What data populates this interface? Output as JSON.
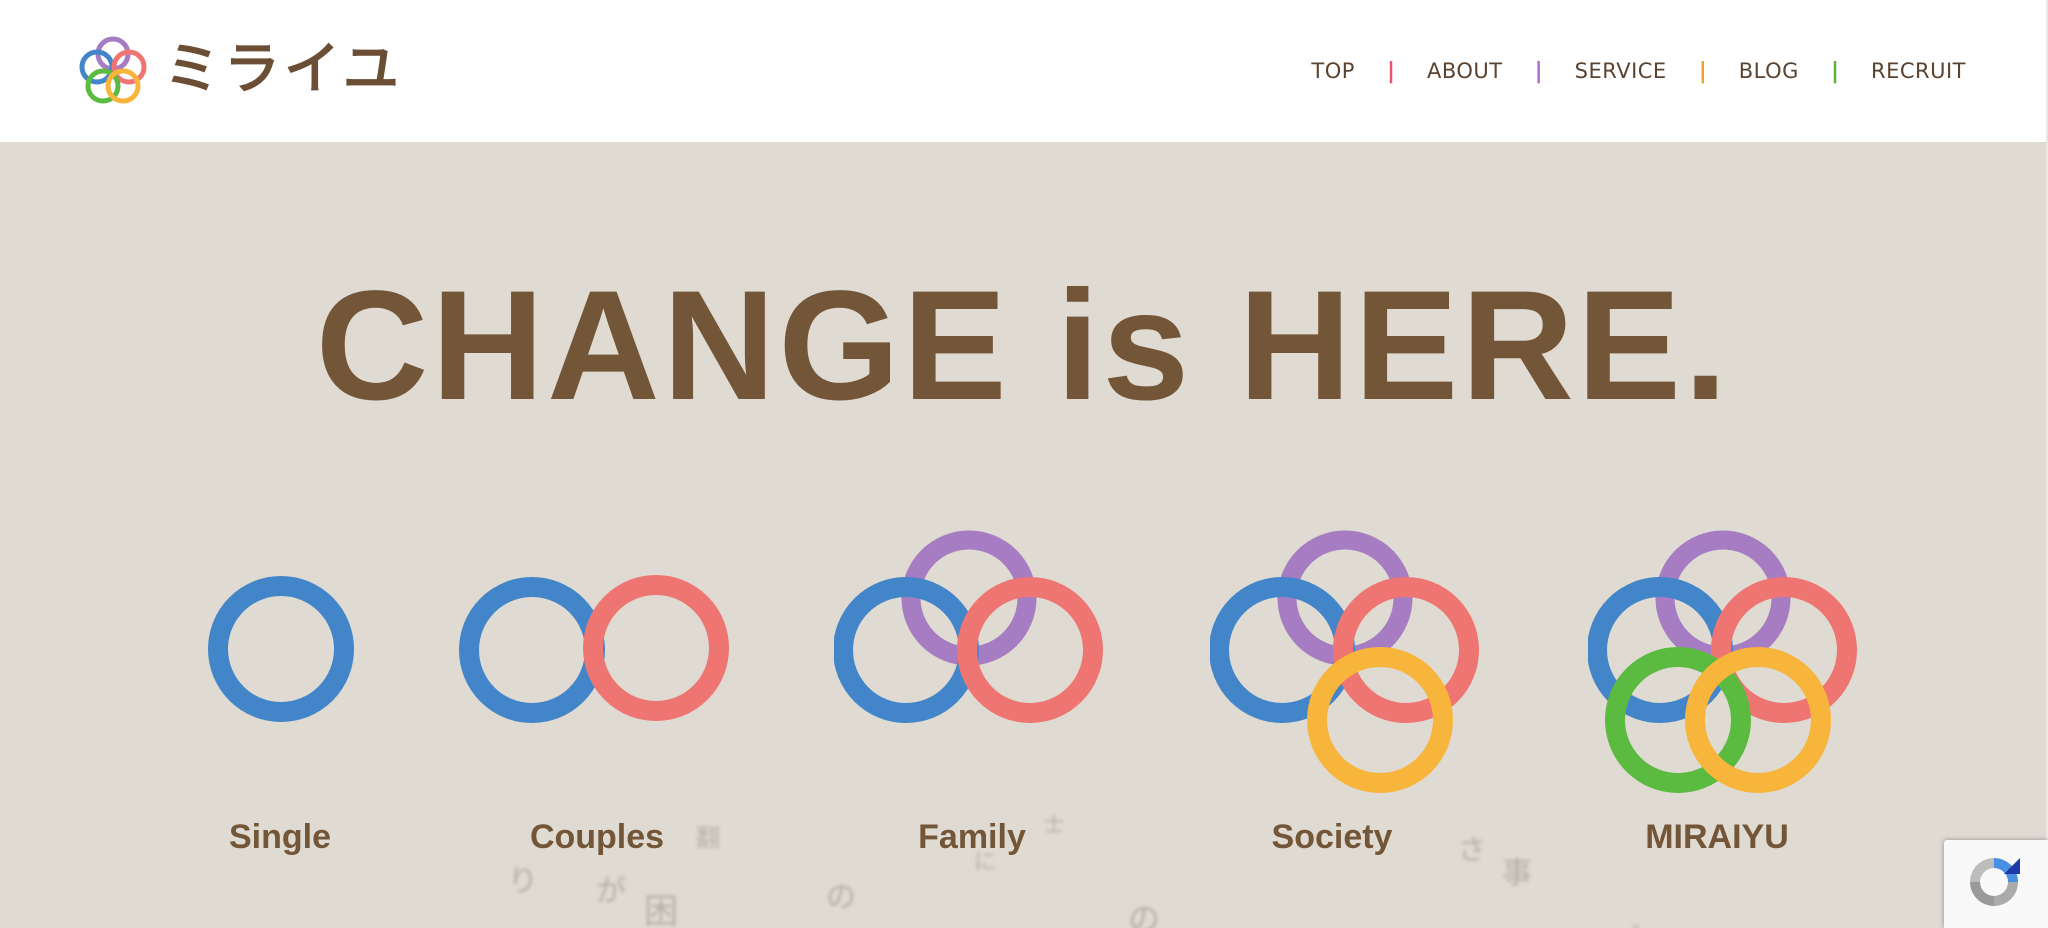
{
  "header": {
    "brand_text": "ミライユ",
    "nav": [
      {
        "label": "TOP"
      },
      {
        "label": "ABOUT"
      },
      {
        "label": "SERVICE"
      },
      {
        "label": "BLOG"
      },
      {
        "label": "RECRUIT"
      }
    ],
    "separators": [
      {
        "char": "|",
        "color": "#e8566e"
      },
      {
        "char": "|",
        "color": "#a66fc4"
      },
      {
        "char": "|",
        "color": "#f0a12c"
      },
      {
        "char": "|",
        "color": "#5bb13c"
      }
    ]
  },
  "hero": {
    "headline": "CHANGE is HERE.",
    "stages": [
      {
        "label": "Single"
      },
      {
        "label": "Couples"
      },
      {
        "label": "Family"
      },
      {
        "label": "Society"
      },
      {
        "label": "MIRAIYU"
      }
    ],
    "floating_chars": [
      "り",
      "が",
      "困",
      "の",
      "の",
      "翻",
      "に",
      "士",
      "さ",
      "事",
      "。"
    ]
  },
  "colors": {
    "brown": "#735538",
    "hero_bg": "#dfdad2",
    "ring_blue": "#4285c9",
    "ring_red": "#ee7571",
    "ring_purple": "#a67cc2",
    "ring_yellow": "#f8b53c",
    "ring_green": "#5bbb40"
  },
  "icons": {
    "logo": "miraiyu-rings-logo",
    "recaptcha": "recaptcha-icon"
  }
}
